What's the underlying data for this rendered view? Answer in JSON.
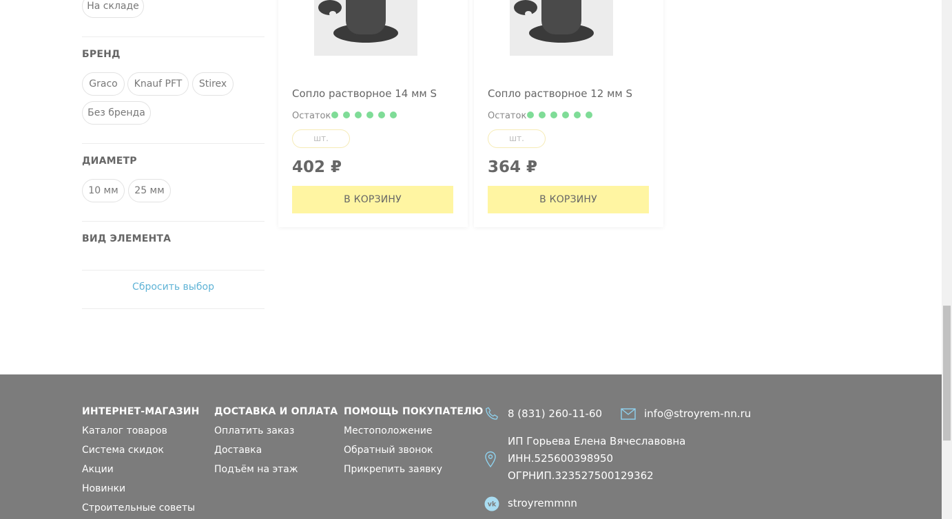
{
  "filters": {
    "availability_chip": "На складе",
    "brand_title": "БРЕНД",
    "brands": [
      "Graco",
      "Knauf PFT",
      "Stirex",
      "Без бренда"
    ],
    "diameter_title": "ДИАМЕТР",
    "diameters": [
      "10 мм",
      "25 мм"
    ],
    "element_type_title": "ВИД ЭЛЕМЕНТА",
    "reset_label": "Сбросить выбор"
  },
  "products": [
    {
      "name": "Сопло растворное 14 мм S",
      "stock_label": "Остаток",
      "stock_dots": 6,
      "qty_placeholder": "шт.",
      "price": "402 ₽",
      "buy_label": "В КОРЗИНУ"
    },
    {
      "name": "Сопло растворное 12 мм S",
      "stock_label": "Остаток",
      "stock_dots": 6,
      "qty_placeholder": "шт.",
      "price": "364 ₽",
      "buy_label": "В КОРЗИНУ"
    }
  ],
  "footer": {
    "col1": {
      "title": "ИНТЕРНЕТ-МАГАЗИН",
      "links": [
        "Каталог товаров",
        "Система скидок",
        "Акции",
        "Новинки",
        "Строительные советы"
      ]
    },
    "col2": {
      "title": "ДОСТАВКА И ОПЛАТА",
      "links": [
        "Оплатить заказ",
        "Доставка",
        "Подъём на этаж"
      ]
    },
    "col3": {
      "title": "ПОМОЩЬ ПОКУПАТЕЛЮ",
      "links": [
        "Местоположение",
        "Обратный звонок",
        "Прикрепить заявку"
      ]
    },
    "phone": "8 (831) 260-11-60",
    "email": "info@stroyrem-nn.ru",
    "company_name": "ИП Горьева Елена Вячеславовна",
    "inn": "ИНН.525600398950",
    "ogrn": "ОГРНИП.323527500129362",
    "vk": "stroyremmnn"
  },
  "colors": {
    "accent_button": "#fff5a2",
    "stock_dot": "#7fdc97",
    "link": "#5fb3d6",
    "footer_bg": "#7c7c7c"
  },
  "icons": [
    "phone-icon",
    "mail-icon",
    "location-pin-icon",
    "vk-icon"
  ]
}
